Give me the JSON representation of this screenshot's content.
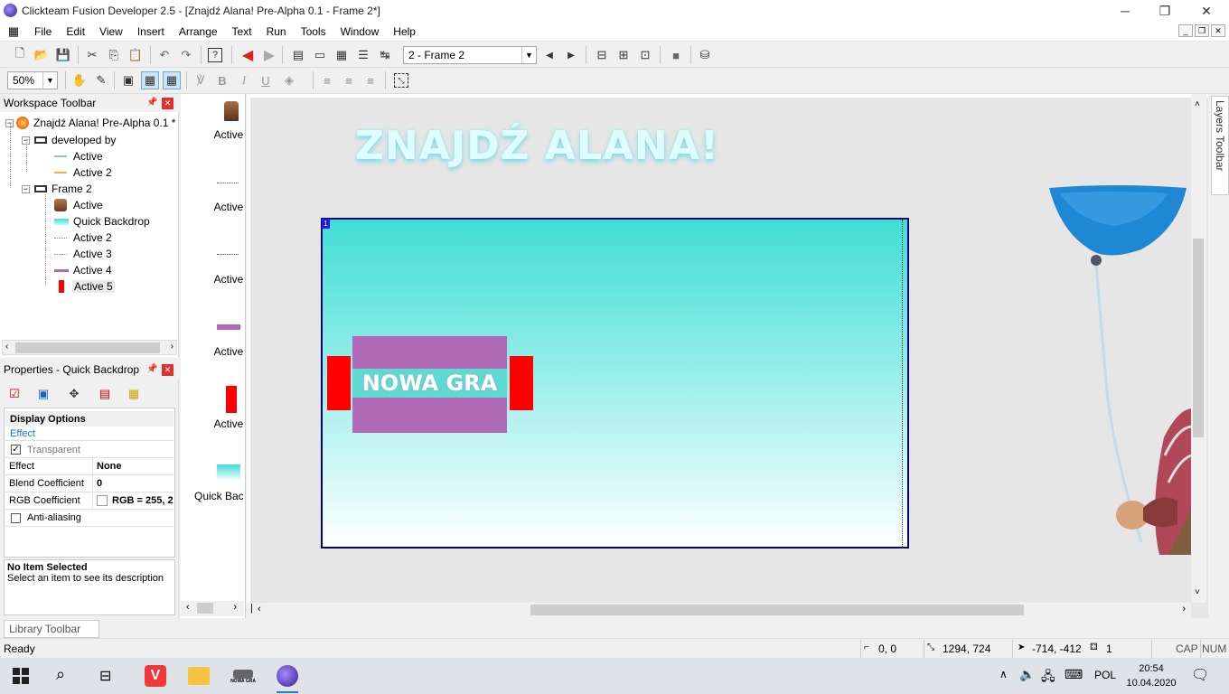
{
  "window": {
    "title": "Clickteam Fusion Developer 2.5 - [Znajdź Alana! Pre-Alpha 0.1 - Frame 2*]"
  },
  "menu": [
    "File",
    "Edit",
    "View",
    "Insert",
    "Arrange",
    "Text",
    "Run",
    "Tools",
    "Window",
    "Help"
  ],
  "toolbar": {
    "frame_select": "2 - Frame 2",
    "zoom": "50%"
  },
  "workspace": {
    "title": "Workspace Toolbar",
    "tree": [
      {
        "label": "Znajdź Alana! Pre-Alpha 0.1 *",
        "level": 0,
        "icon": "app-icon"
      },
      {
        "label": "developed by",
        "level": 1,
        "icon": "frame-icon"
      },
      {
        "label": "Active",
        "level": 2,
        "icon": "active-thin-line-icon"
      },
      {
        "label": "Active 2",
        "level": 2,
        "icon": "active-orange-line-icon"
      },
      {
        "label": "Frame 2",
        "level": 1,
        "icon": "frame-icon"
      },
      {
        "label": "Active",
        "level": 2,
        "icon": "active-alan-icon"
      },
      {
        "label": "Quick Backdrop",
        "level": 2,
        "icon": "quick-backdrop-icon"
      },
      {
        "label": "Active 2",
        "level": 2,
        "icon": "active-dots-icon"
      },
      {
        "label": "Active 3",
        "level": 2,
        "icon": "active-dots-icon"
      },
      {
        "label": "Active 4",
        "level": 2,
        "icon": "purple-bar-icon"
      },
      {
        "label": "Active 5",
        "level": 2,
        "icon": "red-block-icon"
      }
    ]
  },
  "properties": {
    "title": "Properties - Quick Backdrop",
    "section": "Display Options",
    "subsection": "Effect",
    "transparent_label": "Transparent",
    "rows": [
      {
        "key": "Effect",
        "value": "None"
      },
      {
        "key": "Blend Coefficient",
        "value": "0"
      },
      {
        "key": "RGB Coefficient",
        "value": "RGB = 255, 2"
      }
    ],
    "antialiasing_label": "Anti-aliasing",
    "desc_title": "No Item Selected",
    "desc_text": "Select an item to see its description"
  },
  "library": {
    "items": [
      "Active",
      "Active",
      "Active",
      "Active",
      "Active",
      "Quick Bac"
    ],
    "tab": "Library Toolbar"
  },
  "frame": {
    "logo": "ZNAJDŹ ALANA!",
    "layer_marker": "1",
    "button_text": "NOWA GRA",
    "colors": {
      "backdrop_top": "#3fded6",
      "backdrop_bottom": "#ffffff",
      "button": "#b06ab8",
      "red": "#ff0000",
      "balloon": "#1e88d4",
      "frame_border": "#000080"
    }
  },
  "layers_tab": "Layers Toolbar",
  "status": {
    "text": "Ready",
    "origin": "0, 0",
    "size": "1294, 724",
    "cursor": "-714, -412",
    "count": "1",
    "cap": "CAP",
    "num": "NUM"
  },
  "taskbar": {
    "lang": "POL",
    "time": "20:54",
    "date": "10.04.2020",
    "pinned_label": "NOWA GRA"
  }
}
